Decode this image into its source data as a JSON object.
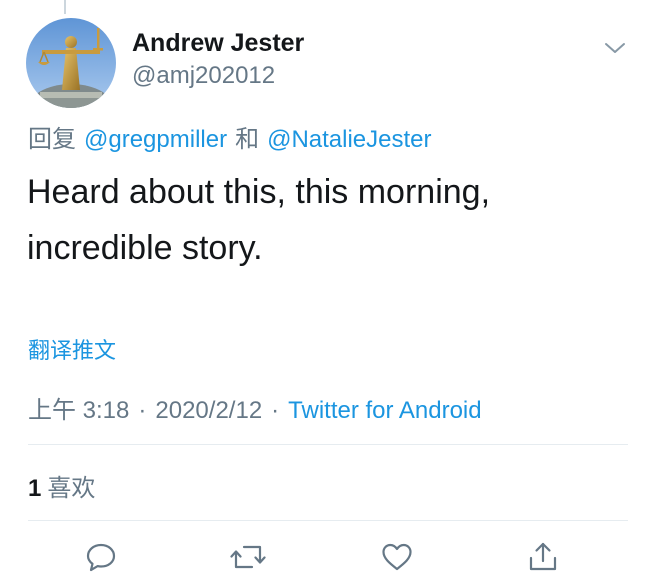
{
  "tweet": {
    "author": {
      "display_name": "Andrew Jester",
      "handle": "@amj202012",
      "avatar_icon": "avatar-justice-statue"
    },
    "reply_to": {
      "prefix": "回复",
      "mention_1": "@gregpmiller",
      "conjunction": "和",
      "mention_2": "@NatalieJester"
    },
    "text": "Heard about this, this morning, incredible story.",
    "translate_label": "翻译推文",
    "meta": {
      "time": "上午 3:18",
      "separator": "·",
      "date": "2020/2/12",
      "source": "Twitter for Android"
    },
    "likes": {
      "count": "1",
      "label": "喜欢"
    },
    "actions": [
      "reply-icon",
      "retweet-icon",
      "like-icon",
      "share-icon"
    ],
    "colors": {
      "link": "#1b95e0",
      "secondary_text": "#657786",
      "primary_text": "#14171a",
      "divider": "#e6ecf0"
    }
  }
}
